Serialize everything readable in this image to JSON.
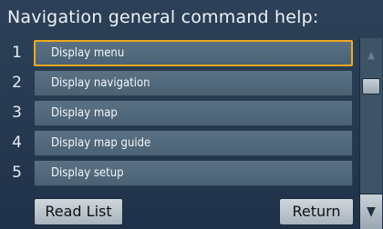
{
  "title": "Navigation general command help:",
  "items": [
    {
      "number": "1",
      "label": "Display menu",
      "selected": true
    },
    {
      "number": "2",
      "label": "Display navigation",
      "selected": false
    },
    {
      "number": "3",
      "label": "Display map",
      "selected": false
    },
    {
      "number": "4",
      "label": "Display map guide",
      "selected": false
    },
    {
      "number": "5",
      "label": "Display setup",
      "selected": false
    }
  ],
  "buttons": {
    "read_list": "Read List",
    "return": "Return"
  },
  "scrollbar": {
    "up_icon": "triangle-up-icon",
    "down_icon": "triangle-down-icon"
  },
  "colors": {
    "selection": "#f2a81d",
    "item": "#536a7d",
    "background": "#2c4158"
  }
}
